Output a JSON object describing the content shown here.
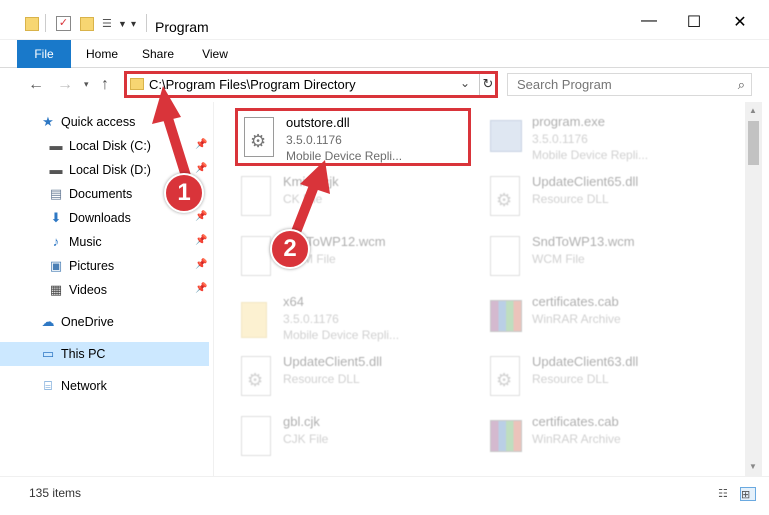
{
  "window": {
    "title": "Program",
    "minimize": "—",
    "maximize": "☐",
    "close": "✕"
  },
  "ribbon": {
    "tabs": [
      {
        "label": "File"
      },
      {
        "label": "Home"
      },
      {
        "label": "Share"
      },
      {
        "label": "View"
      }
    ]
  },
  "address": {
    "path": "C:\\Program Files\\Program Directory",
    "search_placeholder": "Search Program"
  },
  "nav": {
    "items": [
      {
        "label": "Quick access",
        "icon": "star-icon"
      },
      {
        "label": "Local Disk (C:)",
        "icon": "drive-icon"
      },
      {
        "label": "Local Disk (D:)",
        "icon": "drive-icon"
      },
      {
        "label": "Documents",
        "icon": "documents-icon"
      },
      {
        "label": "Downloads",
        "icon": "download-icon"
      },
      {
        "label": "Music",
        "icon": "music-icon"
      },
      {
        "label": "Pictures",
        "icon": "pictures-icon"
      },
      {
        "label": "Videos",
        "icon": "videos-icon"
      },
      {
        "label": "OneDrive",
        "icon": "cloud-icon"
      },
      {
        "label": "This PC",
        "icon": "computer-icon"
      },
      {
        "label": "Network",
        "icon": "network-icon"
      }
    ]
  },
  "files": [
    {
      "name": "outstore.dll",
      "line1": "3.5.0.1176",
      "line2": "Mobile Device Repli..."
    },
    {
      "name": "program.exe",
      "line1": "3.5.0.1176",
      "line2": "Mobile Device Repli..."
    },
    {
      "name": "Kmin.ccjk",
      "line1": "CK File",
      "line2": ""
    },
    {
      "name": "UpdateClient65.dll",
      "line1": "Resource DLL",
      "line2": ""
    },
    {
      "name": "SndToWP12.wcm",
      "line1": "WCM File",
      "line2": ""
    },
    {
      "name": "SndToWP13.wcm",
      "line1": "WCM File",
      "line2": ""
    },
    {
      "name": "x64",
      "line1": "3.5.0.1176",
      "line2": "Mobile Device Repli..."
    },
    {
      "name": "certificates.cab",
      "line1": "WinRAR Archive",
      "line2": ""
    },
    {
      "name": "UpdateClient5.dll",
      "line1": "Resource DLL",
      "line2": ""
    },
    {
      "name": "UpdateClient63.dll",
      "line1": "Resource DLL",
      "line2": ""
    },
    {
      "name": "gbl.cjk",
      "line1": "CJK File",
      "line2": ""
    },
    {
      "name": "certificates.cab",
      "line1": "WinRAR Archive",
      "line2": ""
    }
  ],
  "status": {
    "count": "135 items"
  },
  "callouts": {
    "one": "1",
    "two": "2"
  },
  "colors": {
    "highlight": "#d9343a",
    "file_tab": "#1979ca",
    "selected_nav": "#cce8ff"
  }
}
